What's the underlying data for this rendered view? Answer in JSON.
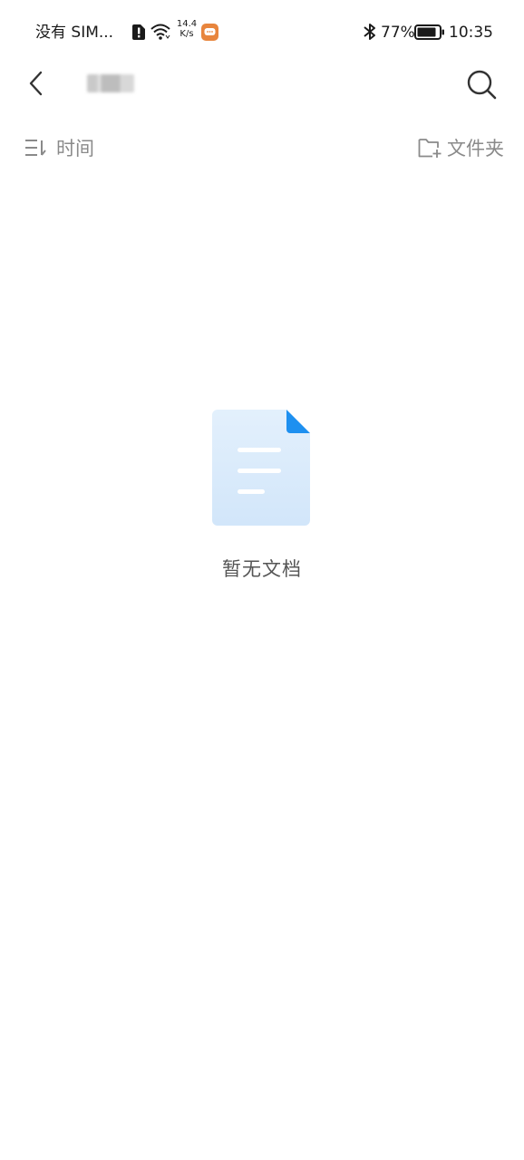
{
  "status_bar": {
    "carrier": "没有 SIM...",
    "net_speed_value": "14.4",
    "net_speed_unit": "K/s",
    "battery_percent": "77%",
    "time": "10:35",
    "icons": [
      "sim-alert-icon",
      "wifi-icon",
      "message-notification-icon",
      "bluetooth-icon",
      "battery-icon"
    ]
  },
  "header": {
    "back_icon": "chevron-left-icon",
    "folder_name": "",
    "search_icon": "search-icon"
  },
  "toolbar": {
    "sort_label": "时间",
    "sort_icon": "sort-icon",
    "new_folder_label": "文件夹",
    "new_folder_icon": "folder-add-icon"
  },
  "empty_state": {
    "icon": "document-icon",
    "message": "暂无文档"
  },
  "colors": {
    "accent": "#1e90f0",
    "doc_fill": "#dcecfb",
    "secondary_text": "#8a8a8a"
  }
}
